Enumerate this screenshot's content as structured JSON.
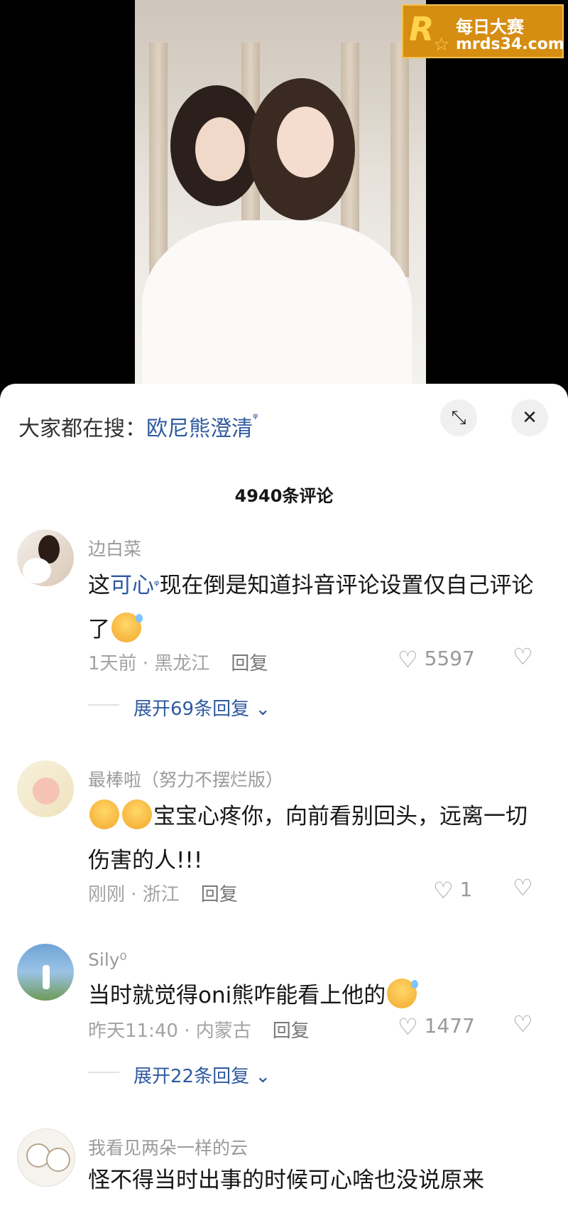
{
  "watermark": {
    "brand": "每日大赛",
    "site": "mrds34.com",
    "logo": "R"
  },
  "search": {
    "prefix": "大家都在搜：",
    "term": "欧尼熊澄清",
    "term_icon": "search-icon"
  },
  "comments_count": "4940条评论",
  "comments": [
    {
      "user": "边白菜",
      "text_pre": "这",
      "text_link": "可心",
      "text_post": "现在倒是知道抖音评论设置仅自己评论了",
      "meta": "1天前 · 黑龙江",
      "reply": "回复",
      "likes": "5597",
      "expand": "展开69条回复"
    },
    {
      "user": "最棒啦（努力不摆烂版）",
      "text": "宝宝心疼你，向前看别回头，远离一切伤害的人!!!",
      "meta": "刚刚 · 浙江",
      "reply": "回复",
      "likes": "1"
    },
    {
      "user": "Sily⁰",
      "text": "当时就觉得oni熊咋能看上他的",
      "meta": "昨天11:40 · 内蒙古",
      "reply": "回复",
      "likes": "1477",
      "expand": "展开22条回复"
    },
    {
      "user": "我看见两朵一样的云",
      "text": "怪不得当时出事的时候可心啥也没说原来"
    }
  ]
}
